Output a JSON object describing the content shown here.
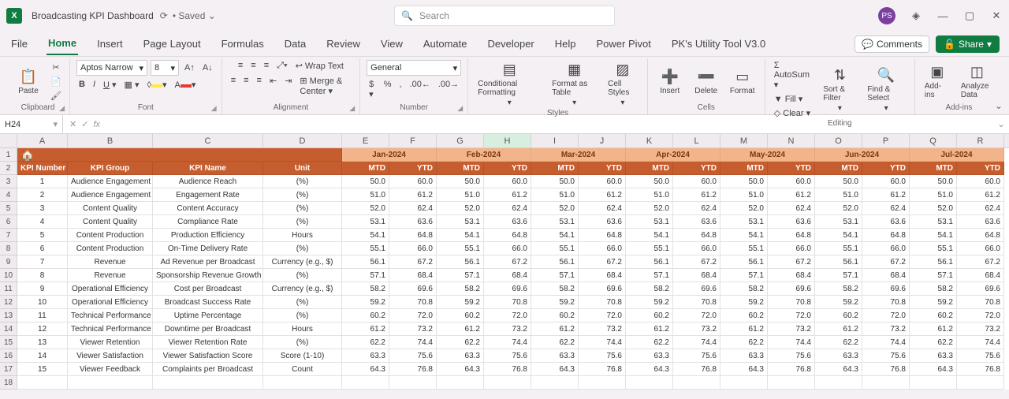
{
  "title": "Broadcasting KPI Dashboard",
  "saved": "Saved",
  "search_placeholder": "Search",
  "avatar": "PS",
  "tabs": [
    "File",
    "Home",
    "Insert",
    "Page Layout",
    "Formulas",
    "Data",
    "Review",
    "View",
    "Automate",
    "Developer",
    "Help",
    "Power Pivot",
    "PK's Utility Tool V3.0"
  ],
  "comments": "Comments",
  "share": "Share",
  "ribbon": {
    "paste": "Paste",
    "clipboard": "Clipboard",
    "font_name": "Aptos Narrow",
    "font_size": "8",
    "font": "Font",
    "wrap": "Wrap Text",
    "merge": "Merge & Center",
    "alignment": "Alignment",
    "numfmt": "General",
    "number": "Number",
    "cond": "Conditional Formatting",
    "fmtas": "Format as Table",
    "cellsty": "Cell Styles",
    "styles": "Styles",
    "insert": "Insert",
    "delete": "Delete",
    "format": "Format",
    "cells": "Cells",
    "autosum": "AutoSum",
    "fill": "Fill",
    "clear": "Clear",
    "sort": "Sort & Filter",
    "find": "Find & Select",
    "editing": "Editing",
    "addins": "Add-ins",
    "analyze": "Analyze Data",
    "addins_lbl": "Add-ins"
  },
  "namebox": "H24",
  "columns": [
    "A",
    "B",
    "C",
    "D",
    "E",
    "F",
    "G",
    "H",
    "I",
    "J",
    "K",
    "L",
    "M",
    "N",
    "O",
    "P",
    "Q",
    "R"
  ],
  "months": [
    "Jan-2024",
    "Feb-2024",
    "Mar-2024",
    "Apr-2024",
    "May-2024",
    "Jun-2024",
    "Jul-2024"
  ],
  "headers": [
    "KPI Number",
    "KPI Group",
    "KPI Name",
    "Unit"
  ],
  "mtd": "MTD",
  "ytd": "YTD",
  "rows": [
    {
      "n": "1",
      "g": "Audience Engagement",
      "k": "Audience Reach",
      "u": "(%)",
      "m": "50.0",
      "y": "60.0"
    },
    {
      "n": "2",
      "g": "Audience Engagement",
      "k": "Engagement Rate",
      "u": "(%)",
      "m": "51.0",
      "y": "61.2"
    },
    {
      "n": "3",
      "g": "Content Quality",
      "k": "Content Accuracy",
      "u": "(%)",
      "m": "52.0",
      "y": "62.4"
    },
    {
      "n": "4",
      "g": "Content Quality",
      "k": "Compliance Rate",
      "u": "(%)",
      "m": "53.1",
      "y": "63.6"
    },
    {
      "n": "5",
      "g": "Content Production",
      "k": "Production Efficiency",
      "u": "Hours",
      "m": "54.1",
      "y": "64.8"
    },
    {
      "n": "6",
      "g": "Content Production",
      "k": "On-Time Delivery Rate",
      "u": "(%)",
      "m": "55.1",
      "y": "66.0"
    },
    {
      "n": "7",
      "g": "Revenue",
      "k": "Ad Revenue per Broadcast",
      "u": "Currency (e.g., $)",
      "m": "56.1",
      "y": "67.2"
    },
    {
      "n": "8",
      "g": "Revenue",
      "k": "Sponsorship Revenue Growth",
      "u": "(%)",
      "m": "57.1",
      "y": "68.4"
    },
    {
      "n": "9",
      "g": "Operational Efficiency",
      "k": "Cost per Broadcast",
      "u": "Currency (e.g., $)",
      "m": "58.2",
      "y": "69.6"
    },
    {
      "n": "10",
      "g": "Operational Efficiency",
      "k": "Broadcast Success Rate",
      "u": "(%)",
      "m": "59.2",
      "y": "70.8"
    },
    {
      "n": "11",
      "g": "Technical Performance",
      "k": "Uptime Percentage",
      "u": "(%)",
      "m": "60.2",
      "y": "72.0"
    },
    {
      "n": "12",
      "g": "Technical Performance",
      "k": "Downtime per Broadcast",
      "u": "Hours",
      "m": "61.2",
      "y": "73.2"
    },
    {
      "n": "13",
      "g": "Viewer Retention",
      "k": "Viewer Retention Rate",
      "u": "(%)",
      "m": "62.2",
      "y": "74.4"
    },
    {
      "n": "14",
      "g": "Viewer Satisfaction",
      "k": "Viewer Satisfaction Score",
      "u": "Score (1-10)",
      "m": "63.3",
      "y": "75.6"
    },
    {
      "n": "15",
      "g": "Viewer Feedback",
      "k": "Complaints per Broadcast",
      "u": "Count",
      "m": "64.3",
      "y": "76.8"
    }
  ]
}
